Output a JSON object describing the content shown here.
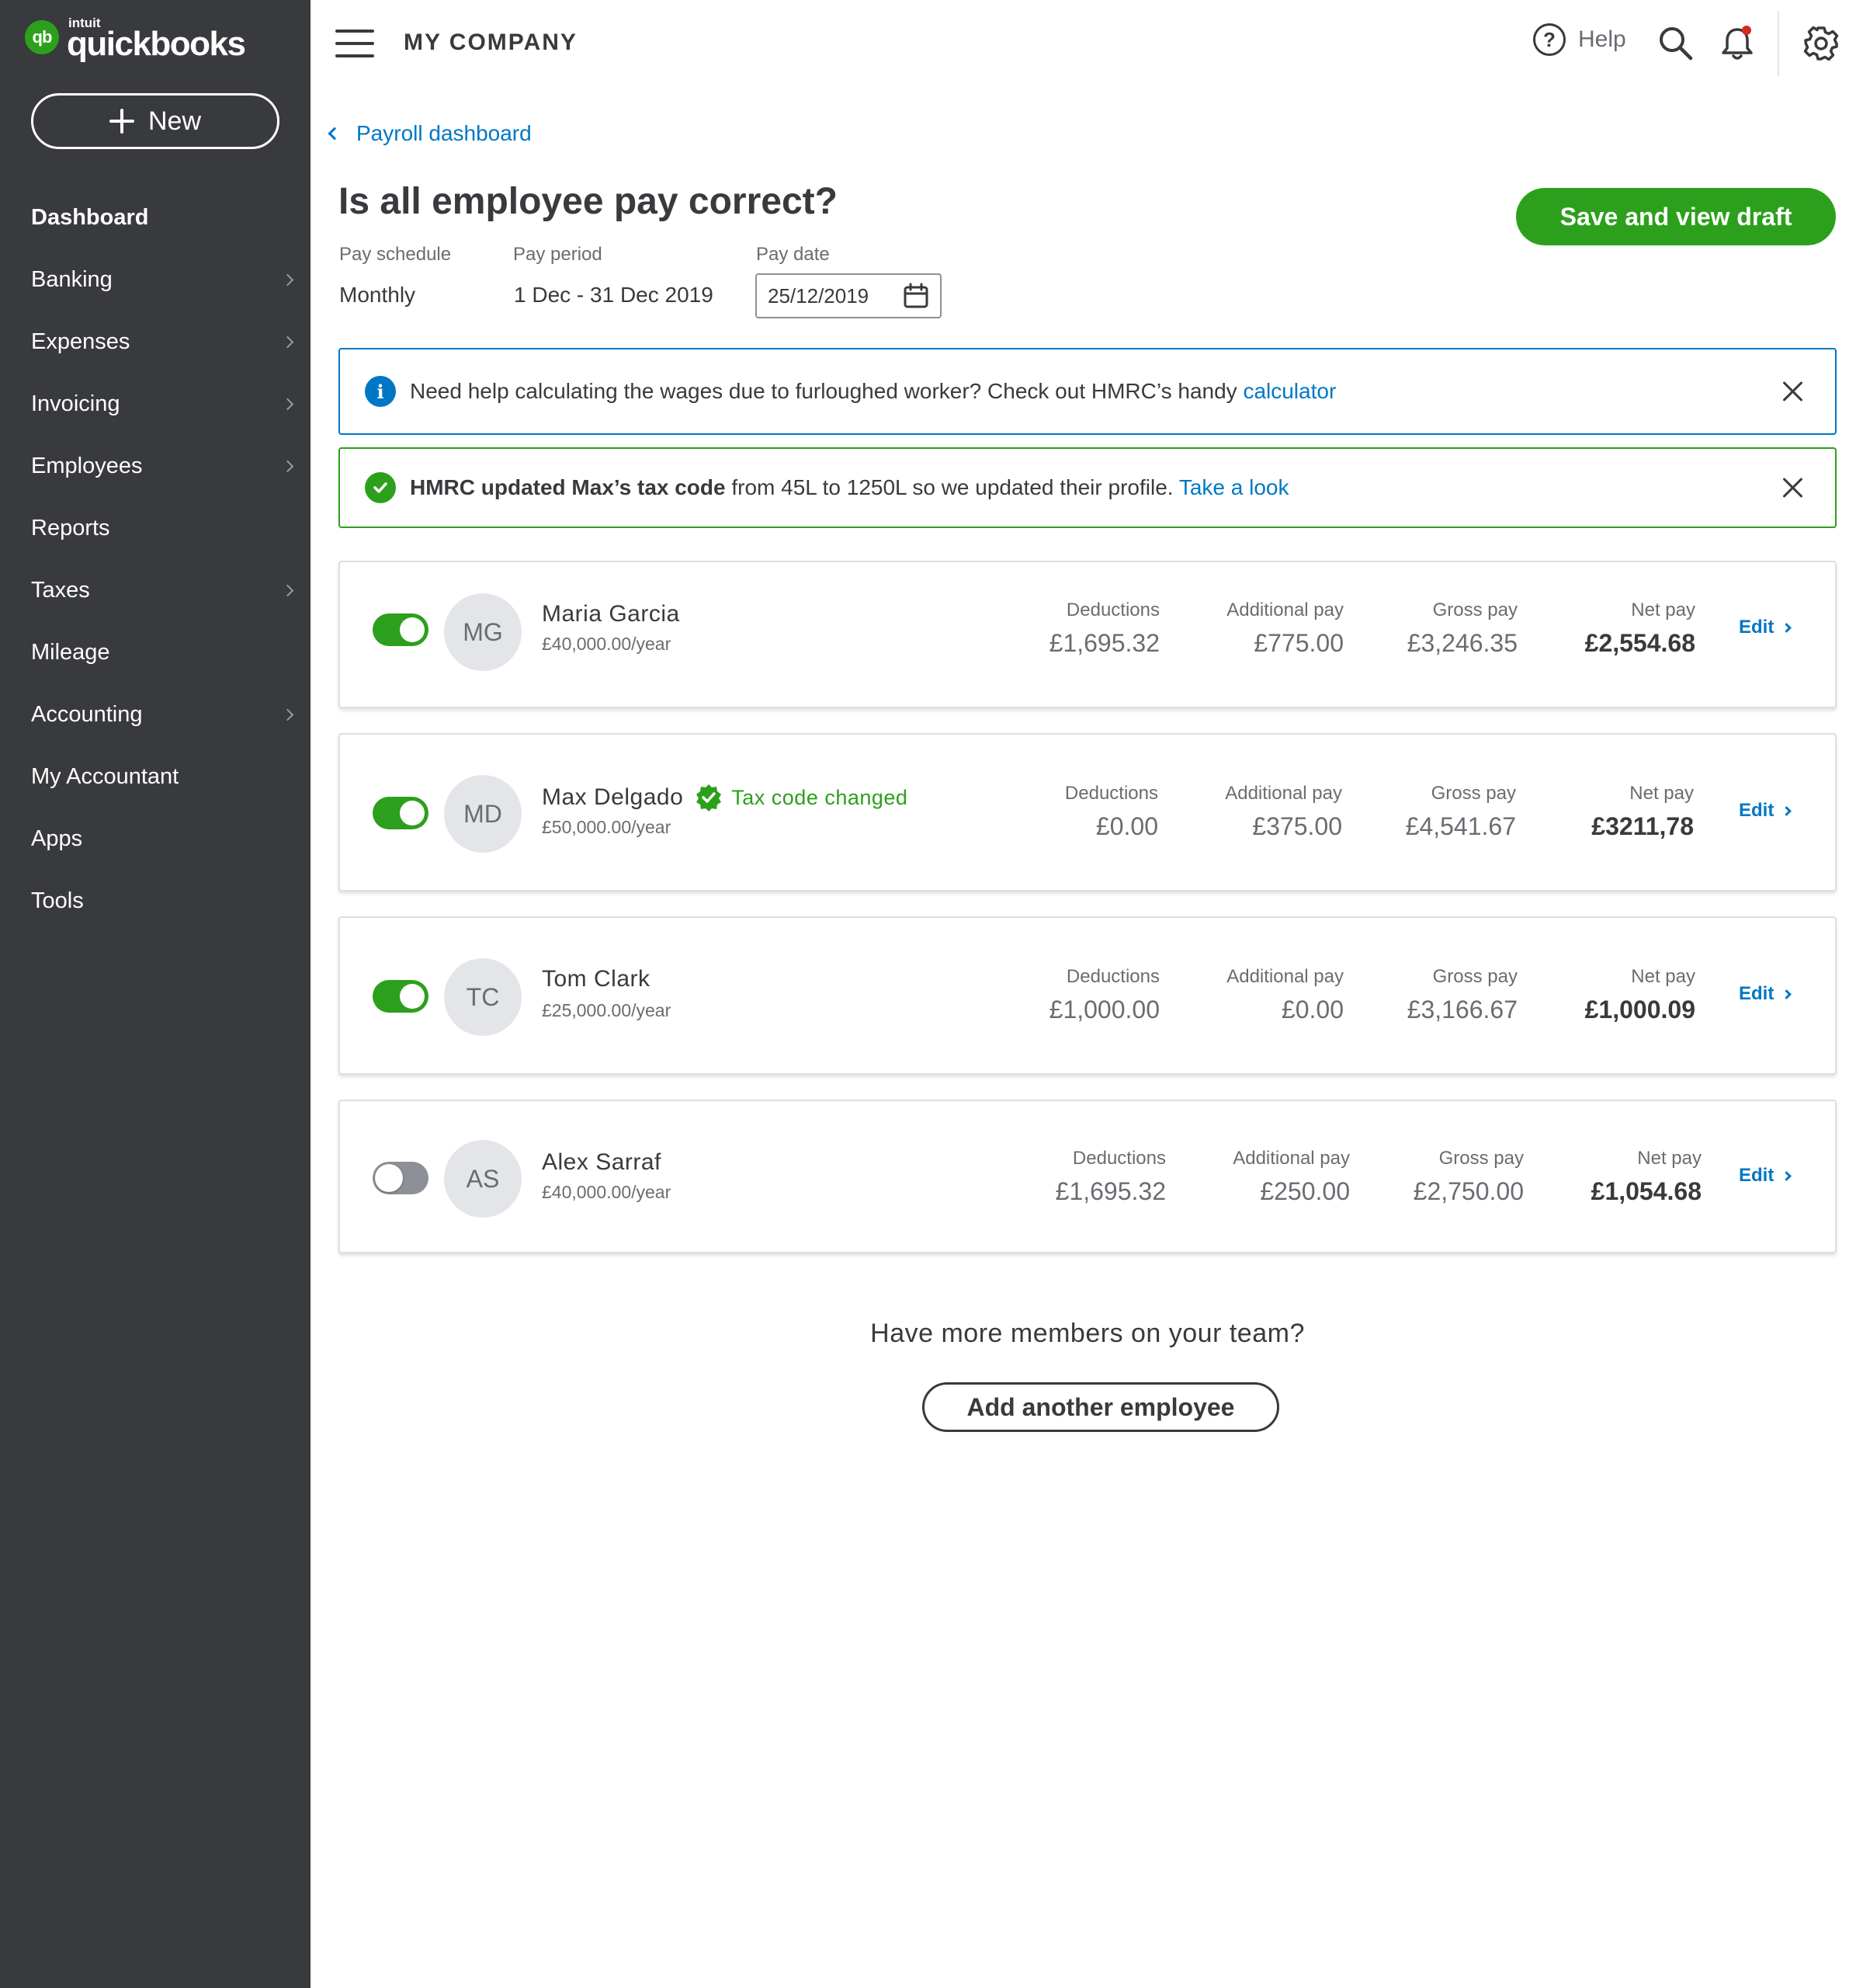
{
  "brand": {
    "intuit": "intuit",
    "name": "quickbooks",
    "mark": "qb",
    "accent": "#2ca01c",
    "sidebar_bg": "#393a3d",
    "link_color": "#0077c5"
  },
  "sidebar": {
    "new_label": "New",
    "items": [
      {
        "label": "Dashboard",
        "chevron": false,
        "active": true
      },
      {
        "label": "Banking",
        "chevron": true
      },
      {
        "label": "Expenses",
        "chevron": true
      },
      {
        "label": "Invoicing",
        "chevron": true
      },
      {
        "label": "Employees",
        "chevron": true
      },
      {
        "label": "Reports",
        "chevron": false
      },
      {
        "label": "Taxes",
        "chevron": true
      },
      {
        "label": "Mileage",
        "chevron": false
      },
      {
        "label": "Accounting",
        "chevron": true
      },
      {
        "label": "My Accountant",
        "chevron": false
      },
      {
        "label": "Apps",
        "chevron": false
      },
      {
        "label": "Tools",
        "chevron": false
      }
    ]
  },
  "header": {
    "company": "MY COMPANY",
    "help_label": "Help",
    "help_glyph": "?",
    "icons": [
      "menu-icon",
      "help-icon",
      "search-icon",
      "bell-icon",
      "gear-icon"
    ]
  },
  "main": {
    "back_label": "Payroll dashboard",
    "title": "Is all employee pay correct?",
    "save_label": "Save and view draft",
    "meta": {
      "schedule_label": "Pay schedule",
      "schedule_value": "Monthly",
      "period_label": "Pay period",
      "period_value": "1 Dec - 31 Dec 2019",
      "date_label": "Pay date",
      "date_value": "25/12/2019"
    },
    "info_alert": {
      "glyph": "i",
      "text": "Need help calculating the wages due to  furloughed worker? Check out HMRC’s handy ",
      "link": "calculator"
    },
    "success_alert": {
      "bold": "HMRC updated Max’s tax code",
      "text": " from 45L to 1250L so we updated their profile. ",
      "link": "Take a look"
    }
  },
  "columns": {
    "deductions": "Deductions",
    "additional": "Additional pay",
    "gross": "Gross pay",
    "net": "Net pay",
    "edit": "Edit"
  },
  "employees": [
    {
      "initials": "MG",
      "name": "Maria Garcia",
      "salary": "£40,000.00/year",
      "enabled": true,
      "badge": "",
      "deductions": "£1,695.32",
      "additional": "£775.00",
      "gross": "£3,246.35",
      "net": "£2,554.68"
    },
    {
      "initials": "MD",
      "name": "Max Delgado",
      "salary": "£50,000.00/year",
      "enabled": true,
      "badge": "Tax code changed",
      "deductions": "£0.00",
      "additional": "£375.00",
      "gross": "£4,541.67",
      "net": "£3211,78"
    },
    {
      "initials": "TC",
      "name": "Tom Clark",
      "salary": "£25,000.00/year",
      "enabled": true,
      "badge": "",
      "deductions": "£1,000.00",
      "additional": "£0.00",
      "gross": "£3,166.67",
      "net": "£1,000.09"
    },
    {
      "initials": "AS",
      "name": "Alex Sarraf",
      "salary": "£40,000.00/year",
      "enabled": false,
      "badge": "",
      "deductions": "£1,695.32",
      "additional": "£250.00",
      "gross": "£2,750.00",
      "net": "£1,054.68"
    }
  ],
  "footer": {
    "question": "Have more members on your team?",
    "add_label": "Add another employee"
  }
}
